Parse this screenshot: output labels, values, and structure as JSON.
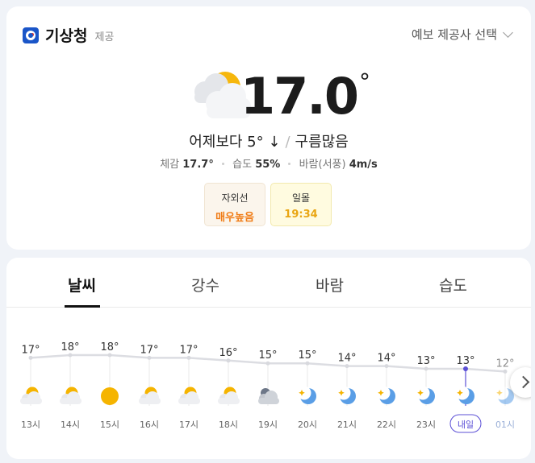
{
  "provider": {
    "name": "기상청",
    "sub": "제공",
    "select_label": "예보 제공사 선택"
  },
  "current": {
    "temperature": "17.0",
    "unit": "°",
    "compare_text": "어제보다 5° ↓",
    "condition": "구름많음",
    "feels_label": "체감",
    "feels_value": "17.7°",
    "humidity_label": "습도",
    "humidity_value": "55%",
    "wind_label": "바람(서풍)",
    "wind_value": "4m/s",
    "icon": "sun-cloud-icon"
  },
  "badges": {
    "uv": {
      "label": "자외선",
      "value": "매우높음"
    },
    "sunset": {
      "label": "일몰",
      "value": "19:34"
    }
  },
  "tabs": [
    {
      "label": "날씨",
      "active": true
    },
    {
      "label": "강수",
      "active": false
    },
    {
      "label": "바람",
      "active": false
    },
    {
      "label": "습도",
      "active": false
    }
  ],
  "colors": {
    "uv": "#f07c16",
    "sunset": "#e9a614",
    "accent": "#5b4fd6",
    "moon": "#5a9ee6",
    "sun": "#f5b400"
  },
  "hourly": {
    "temps": [
      17,
      18,
      18,
      17,
      17,
      16,
      15,
      15,
      14,
      14,
      13,
      13,
      12
    ],
    "temp_labels": [
      "17°",
      "18°",
      "18°",
      "17°",
      "17°",
      "16°",
      "15°",
      "15°",
      "14°",
      "14°",
      "13°",
      "13°",
      "12°"
    ],
    "hours": [
      "13시",
      "14시",
      "15시",
      "16시",
      "17시",
      "18시",
      "19시",
      "20시",
      "21시",
      "22시",
      "23시",
      "내일",
      "01시"
    ],
    "icons": [
      "sun-cloud-icon",
      "sun-cloud-icon",
      "sun-icon",
      "sun-cloud-icon",
      "sun-cloud-icon",
      "sun-cloud-icon",
      "cloud-icon",
      "moon-icon",
      "moon-icon",
      "moon-icon",
      "moon-icon",
      "moon-icon",
      "moon-icon"
    ]
  }
}
